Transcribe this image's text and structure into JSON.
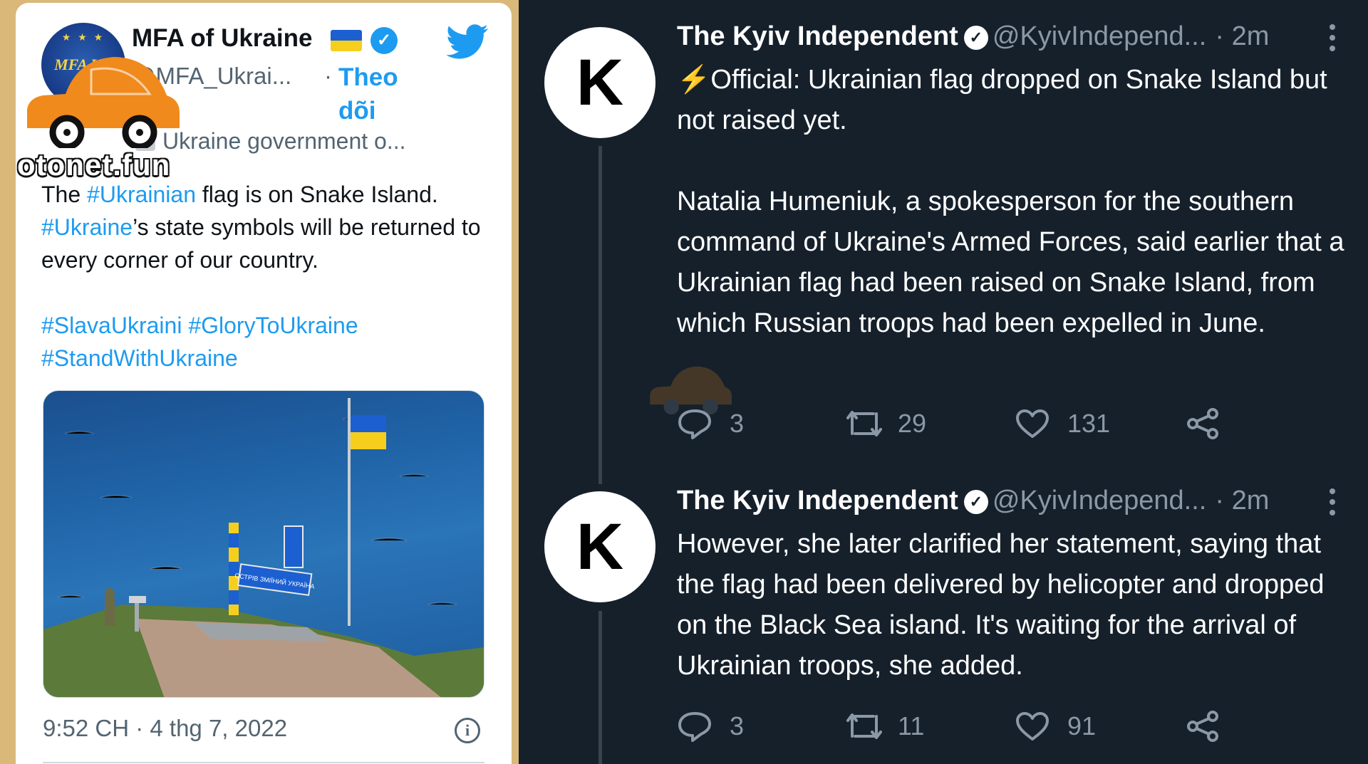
{
  "left_tweet": {
    "avatar_text": "MFA UA",
    "author_name": "MFA of Ukraine",
    "handle": "@MFA_Ukrai...",
    "separator": "·",
    "follow_label": "Theo dõi",
    "affiliation": "Ukraine government o...",
    "body": {
      "tag1": "#Ukrainian",
      "text1": " flag is on Snake Island.",
      "prefix": "The ",
      "tag2": "#Ukraine",
      "text2": "’s state symbols will be returned to every corner of our country.",
      "tag3": "#SlavaUkraini",
      "tag4": "#GloryToUkraine",
      "tag5": "#StandWithUkraine"
    },
    "sign_text": "ОСТРІВ ЗМІЇНИЙ УКРАЇНА",
    "timestamp": "9:52 CH · 4 thg 7, 2022"
  },
  "watermark": {
    "text": "otonet.fun",
    "color": "#f08a1c"
  },
  "thread": [
    {
      "avatar_letter": "K",
      "author_name": "The Kyiv Independent",
      "handle": "@KyivIndepend...",
      "time": "· 2m",
      "paragraphs": [
        "⚡Official: Ukrainian flag dropped on Snake Island but not raised yet.",
        "Natalia Humeniuk, a spokesperson for the southern command of Ukraine's Armed Forces, said earlier that a Ukrainian flag had been raised on Snake Island, from which Russian troops had been expelled in June."
      ],
      "replies": "3",
      "retweets": "29",
      "likes": "131"
    },
    {
      "avatar_letter": "K",
      "author_name": "The Kyiv Independent",
      "handle": "@KyivIndepend...",
      "time": "· 2m",
      "paragraphs": [
        "However, she later clarified her statement, saying that the flag had been delivered by helicopter and dropped on the Black Sea island. It's waiting for the arrival of Ukrainian troops, she added."
      ],
      "replies": "3",
      "retweets": "11",
      "likes": "91"
    }
  ],
  "colors": {
    "frame": "#d9b87a",
    "dark_bg": "#15202b",
    "twitter_blue": "#1d9bf0",
    "muted": "#8b98a5",
    "ua_blue": "#1c5fd1",
    "ua_yellow": "#f6cf1e"
  },
  "icons": [
    "twitter-bird-icon",
    "verified-icon",
    "info-icon",
    "more-icon",
    "reply-icon",
    "retweet-icon",
    "like-icon",
    "share-icon",
    "car-logo-icon"
  ]
}
